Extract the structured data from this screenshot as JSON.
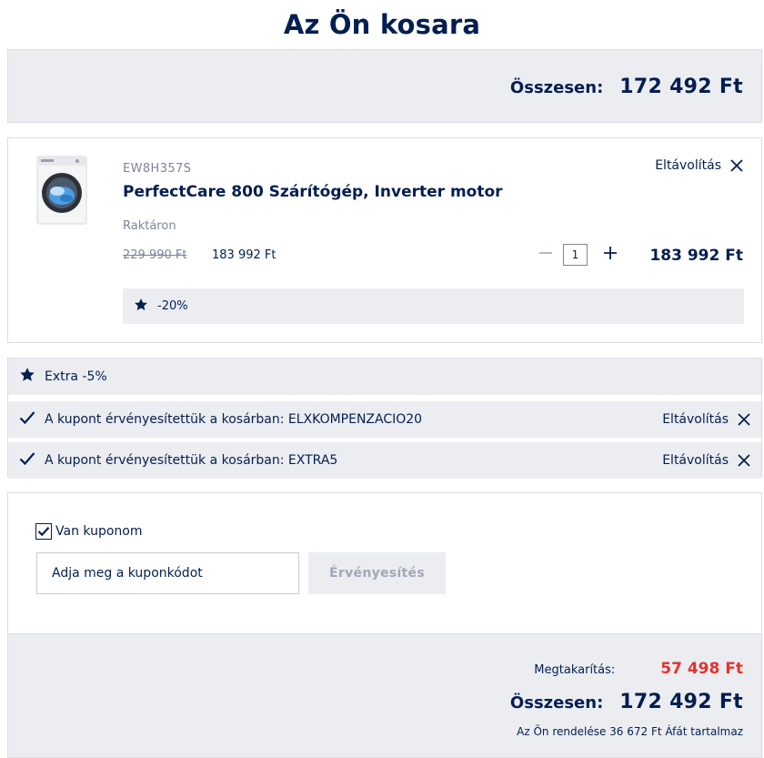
{
  "page": {
    "title": "Az Ön kosara"
  },
  "summary_top": {
    "total_label": "Összesen:",
    "total_value": "172 492 Ft"
  },
  "product": {
    "sku": "EW8H357S",
    "name": "PerfectCare 800 Szárítógép, Inverter motor",
    "stock": "Raktáron",
    "old_price": "229 990 Ft",
    "new_price": "183 992 Ft",
    "quantity": "1",
    "line_total": "183 992 Ft",
    "remove_label": "Eltávolítás",
    "discount_label": "-20%"
  },
  "coupons": {
    "extra_label": "Extra -5%",
    "applied": [
      {
        "text": "A kupont érvényesítettük a kosárban: ELXKOMPENZACIO20",
        "remove_label": "Eltávolítás"
      },
      {
        "text": "A kupont érvényesítettük a kosárban: EXTRA5",
        "remove_label": "Eltávolítás"
      }
    ]
  },
  "coupon_form": {
    "checkbox_label": "Van kuponom",
    "checked": true,
    "input_placeholder": "Adja meg a kuponkódot",
    "apply_label": "Érvényesítés"
  },
  "summary_bottom": {
    "savings_label": "Megtakarítás:",
    "savings_value": "57 498 Ft",
    "total_label": "Összesen:",
    "total_value": "172 492 Ft",
    "vat_note": "Az Ön rendelése 36 672 Ft Áfát tartalmaz"
  },
  "colors": {
    "primary": "#041e50",
    "muted": "#7c8599",
    "panel": "#ebedf1",
    "savings": "#e5322c",
    "border": "#d9dde4"
  },
  "icons": {
    "star": "star-icon",
    "check": "check-icon",
    "close": "close-icon",
    "minus": "minus-icon",
    "plus": "plus-icon"
  }
}
